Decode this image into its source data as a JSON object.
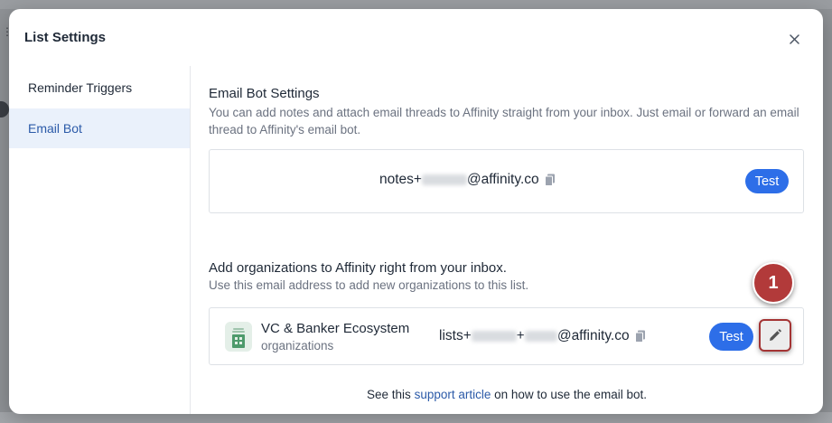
{
  "modal": {
    "title": "List Settings",
    "close_icon": "close-icon"
  },
  "sidebar": {
    "items": [
      {
        "label": "Reminder Triggers",
        "active": false
      },
      {
        "label": "Email Bot",
        "active": true
      }
    ]
  },
  "email_bot": {
    "title": "Email Bot Settings",
    "description": "You can add notes and attach email threads to Affinity straight from your inbox. Just email or forward an email thread to Affinity's email bot.",
    "notes_prefix": "notes+",
    "notes_redacted": "demo-cs",
    "notes_suffix": "@affinity.co",
    "test_label": "Test"
  },
  "organizations": {
    "title": "Add organizations to Affinity right from your inbox.",
    "description": "Use this email address to add new organizations to this list.",
    "list_name": "VC & Banker Ecosystem",
    "list_type": "organizations",
    "lists_prefix": "lists+",
    "lists_redacted_1": "demo-cs",
    "lists_plus": "+",
    "lists_redacted_2": "85877",
    "lists_suffix": "@affinity.co",
    "test_label": "Test",
    "edit_icon": "pencil-icon"
  },
  "annotation": {
    "step_number": "1",
    "color": "#b23a3a"
  },
  "footer": {
    "before": "See this ",
    "link": "support article",
    "after": " on how to use the email bot."
  },
  "colors": {
    "accent": "#2d6ee8",
    "active_bg": "#eaf1fb",
    "active_text": "#2b5aa8"
  }
}
